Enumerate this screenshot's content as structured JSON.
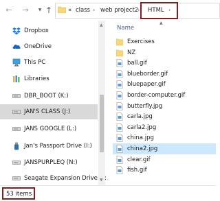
{
  "address_bar": {
    "overflow_label": "«",
    "segments": [
      "class",
      "web project2",
      "HTML"
    ],
    "separator": "›"
  },
  "nav_pane": {
    "items": [
      {
        "label": "Dropbox",
        "icon": "dropbox-icon",
        "selected": false
      },
      {
        "label": "OneDrive",
        "icon": "onedrive-icon",
        "selected": false
      },
      {
        "label": "This PC",
        "icon": "this-pc-icon",
        "selected": false
      },
      {
        "label": "Libraries",
        "icon": "libraries-icon",
        "selected": false
      },
      {
        "label": "DBR_BOOT (K:)",
        "icon": "drive-icon",
        "selected": false
      },
      {
        "label": "JAN'S CLASS (J:)",
        "icon": "drive-icon",
        "selected": true
      },
      {
        "label": "JANS GOOGLE (L:)",
        "icon": "drive-icon",
        "selected": false
      },
      {
        "label": "Jan's Passport Drive (I:)",
        "icon": "usb-drive-icon",
        "selected": false
      },
      {
        "label": "JANSPURPLEQ (N:)",
        "icon": "drive-icon",
        "selected": false
      },
      {
        "label": "Seagate Expansion Drive (F:",
        "icon": "drive-icon",
        "selected": false
      }
    ]
  },
  "content": {
    "column_header": "Name",
    "files": [
      {
        "name": "Exercises",
        "type": "folder",
        "selected": false
      },
      {
        "name": "NZ",
        "type": "folder",
        "selected": false
      },
      {
        "name": "ball.gif",
        "type": "image",
        "selected": false
      },
      {
        "name": "blueborder.gif",
        "type": "image",
        "selected": false
      },
      {
        "name": "bluepaper.gif",
        "type": "image",
        "selected": false
      },
      {
        "name": "border-computer.gif",
        "type": "image",
        "selected": false
      },
      {
        "name": "butterfly.jpg",
        "type": "image",
        "selected": false
      },
      {
        "name": "carla.jpg",
        "type": "image",
        "selected": false
      },
      {
        "name": "carla2.jpg",
        "type": "image",
        "selected": false
      },
      {
        "name": "china.jpg",
        "type": "image",
        "selected": false
      },
      {
        "name": "china2.jpg",
        "type": "image",
        "selected": true
      },
      {
        "name": "clear.gif",
        "type": "image",
        "selected": false
      },
      {
        "name": "fish.gif",
        "type": "image",
        "selected": false
      }
    ]
  },
  "status_bar": {
    "item_count": "53 items"
  },
  "colors": {
    "highlight_border": "#8b1a1a",
    "selected_nav": "#d9d9d9",
    "selected_file": "#cce8ff",
    "folder_yellow": "#f8d775"
  }
}
